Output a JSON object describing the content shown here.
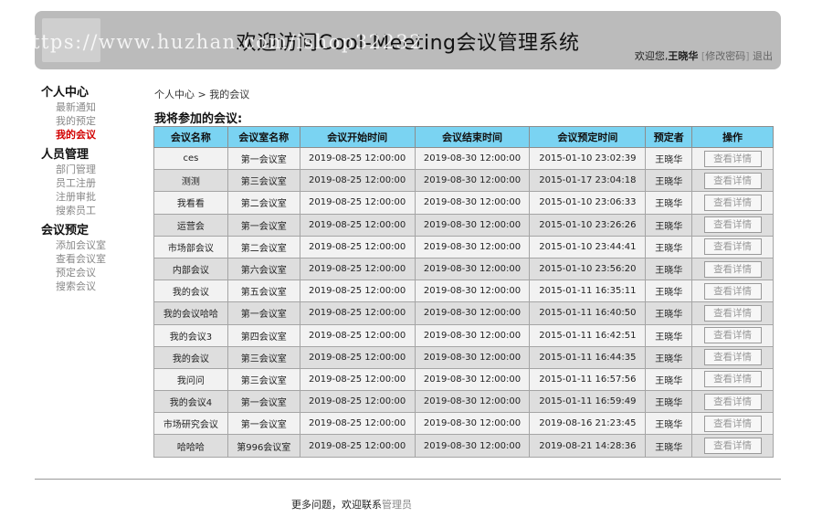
{
  "header": {
    "title": "欢迎访问Cool-Meeting会议管理系统",
    "welcome_prefix": "欢迎您,",
    "username": "王晓华",
    "change_password": "修改密码",
    "logout": "退出",
    "watermark": "https://www.huzhan.com/ishop32232"
  },
  "sidebar": {
    "groups": [
      {
        "title": "个人中心",
        "items": [
          "最新通知",
          "我的预定",
          "我的会议"
        ]
      },
      {
        "title": "人员管理",
        "items": [
          "部门管理",
          "员工注册",
          "注册审批",
          "搜索员工"
        ]
      },
      {
        "title": "会议预定",
        "items": [
          "添加会议室",
          "查看会议室",
          "预定会议",
          "搜索会议"
        ]
      }
    ],
    "active_item": "我的会议"
  },
  "main": {
    "breadcrumb": "个人中心 > 我的会议",
    "list_title": "我将参加的会议:",
    "columns": [
      "会议名称",
      "会议室名称",
      "会议开始时间",
      "会议结束时间",
      "会议预定时间",
      "预定者",
      "操作"
    ],
    "detail_label": "查看详情",
    "rows": [
      [
        "ces",
        "第一会议室",
        "2019-08-25 12:00:00",
        "2019-08-30 12:00:00",
        "2015-01-10 23:02:39",
        "王晓华"
      ],
      [
        "测测",
        "第三会议室",
        "2019-08-25 12:00:00",
        "2019-08-30 12:00:00",
        "2015-01-17 23:04:18",
        "王晓华"
      ],
      [
        "我看看",
        "第二会议室",
        "2019-08-25 12:00:00",
        "2019-08-30 12:00:00",
        "2015-01-10 23:06:33",
        "王晓华"
      ],
      [
        "运营会",
        "第一会议室",
        "2019-08-25 12:00:00",
        "2019-08-30 12:00:00",
        "2015-01-10 23:26:26",
        "王晓华"
      ],
      [
        "市场部会议",
        "第二会议室",
        "2019-08-25 12:00:00",
        "2019-08-30 12:00:00",
        "2015-01-10 23:44:41",
        "王晓华"
      ],
      [
        "内部会议",
        "第六会议室",
        "2019-08-25 12:00:00",
        "2019-08-30 12:00:00",
        "2015-01-10 23:56:20",
        "王晓华"
      ],
      [
        "我的会议",
        "第五会议室",
        "2019-08-25 12:00:00",
        "2019-08-30 12:00:00",
        "2015-01-11 16:35:11",
        "王晓华"
      ],
      [
        "我的会议哈哈",
        "第一会议室",
        "2019-08-25 12:00:00",
        "2019-08-30 12:00:00",
        "2015-01-11 16:40:50",
        "王晓华"
      ],
      [
        "我的会议3",
        "第四会议室",
        "2019-08-25 12:00:00",
        "2019-08-30 12:00:00",
        "2015-01-11 16:42:51",
        "王晓华"
      ],
      [
        "我的会议",
        "第三会议室",
        "2019-08-25 12:00:00",
        "2019-08-30 12:00:00",
        "2015-01-11 16:44:35",
        "王晓华"
      ],
      [
        "我问问",
        "第三会议室",
        "2019-08-25 12:00:00",
        "2019-08-30 12:00:00",
        "2015-01-11 16:57:56",
        "王晓华"
      ],
      [
        "我的会议4",
        "第一会议室",
        "2019-08-25 12:00:00",
        "2019-08-30 12:00:00",
        "2015-01-11 16:59:49",
        "王晓华"
      ],
      [
        "市场研究会议",
        "第一会议室",
        "2019-08-25 12:00:00",
        "2019-08-30 12:00:00",
        "2019-08-16 21:23:45",
        "王晓华"
      ],
      [
        "哈哈哈",
        "第996会议室",
        "2019-08-25 12:00:00",
        "2019-08-30 12:00:00",
        "2019-08-21 14:28:36",
        "王晓华"
      ]
    ]
  },
  "footer": {
    "text": "更多问题，欢迎联系",
    "link": "管理员"
  },
  "colors": {
    "header_bg": "#bbbbbb",
    "table_header_bg": "#7ad3f2",
    "active_nav": "#d20000"
  }
}
